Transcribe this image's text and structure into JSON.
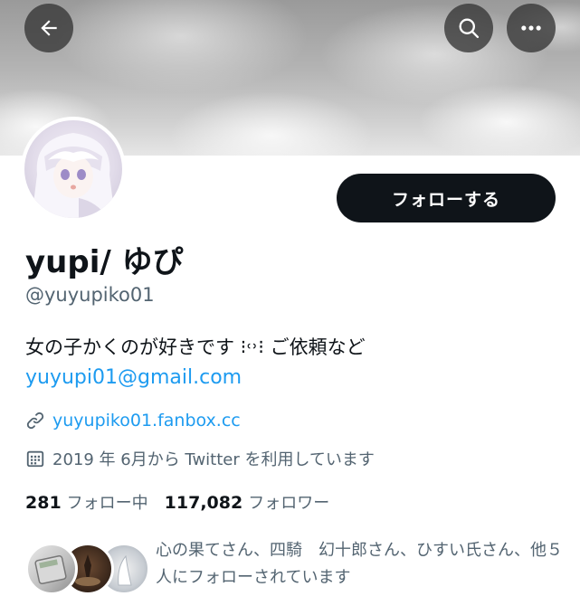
{
  "header": {
    "back_icon": "arrow-left-icon",
    "search_icon": "search-icon",
    "more_icon": "more-horizontal-icon"
  },
  "profile": {
    "follow_label": "フォローする",
    "display_name": "yupi/ ゆぴ",
    "handle": "@yuyupiko01",
    "bio": "女の子かくのが好きです ⁝˓˒⁝ ご依頼など",
    "email": "yuyupi01@gmail.com",
    "link": "yuyupiko01.fanbox.cc",
    "link_icon": "link-icon",
    "joined": "2019 年 6月から Twitter を利用しています",
    "joined_icon": "calendar-icon"
  },
  "stats": {
    "following_count": "281",
    "following_label": "フォロー中",
    "followers_count": "117,082",
    "followers_label": "フォロワー"
  },
  "followed_by": {
    "text": "心の果てさん、四騎　幻十郎さん、ひすい氏さん、他５人にフォローされています"
  },
  "colors": {
    "accent": "#1d9bf0",
    "primary_text": "#0f1419",
    "secondary_text": "#536471",
    "button_dark": "#0f1419"
  }
}
